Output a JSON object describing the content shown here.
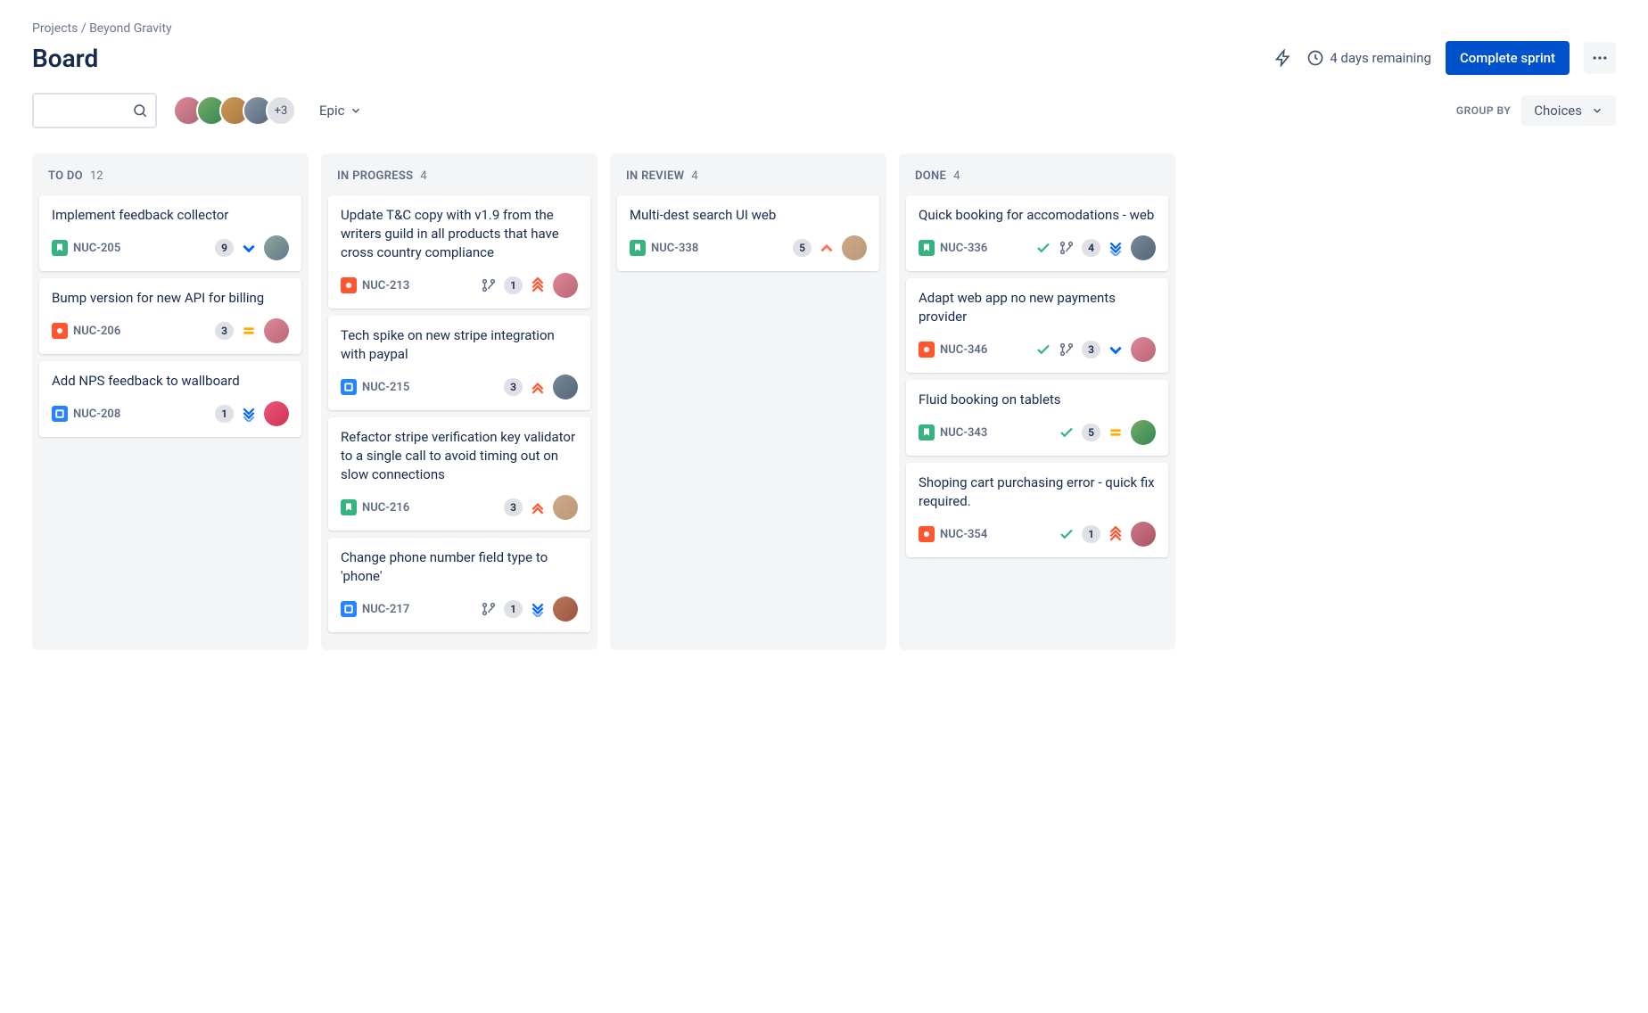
{
  "breadcrumb": {
    "projects": "Projects",
    "project_name": "Beyond Gravity"
  },
  "page_title": "Board",
  "header": {
    "time_remaining": "4 days remaining",
    "complete_sprint": "Complete sprint"
  },
  "toolbar": {
    "search_placeholder": "",
    "avatar_more": "+3",
    "epic_label": "Epic",
    "group_by_label": "GROUP BY",
    "choices_label": "Choices"
  },
  "columns": [
    {
      "title": "TO DO",
      "count": "12",
      "cards": [
        {
          "title": "Implement feedback collector",
          "type": "story",
          "key": "NUC-205",
          "estimate": "9",
          "priority": "low",
          "avatar": "a1"
        },
        {
          "title": "Bump version for new API for billing",
          "type": "bug",
          "key": "NUC-206",
          "estimate": "3",
          "priority": "medium",
          "avatar": "a2"
        },
        {
          "title": "Add NPS feedback to wallboard",
          "type": "task",
          "key": "NUC-208",
          "estimate": "1",
          "priority": "lowest",
          "avatar": "a3"
        }
      ]
    },
    {
      "title": "IN PROGRESS",
      "count": "4",
      "cards": [
        {
          "title": "Update T&C copy with v1.9 from the writers guild in all products that have cross country compliance",
          "type": "bug",
          "key": "NUC-213",
          "estimate": "1",
          "priority": "highest",
          "branch": true,
          "avatar": "a4"
        },
        {
          "title": "Tech spike on new stripe integration with paypal",
          "type": "task",
          "key": "NUC-215",
          "estimate": "3",
          "priority": "high",
          "avatar": "a5"
        },
        {
          "title": "Refactor stripe verification key validator to a single call to avoid timing out on slow connections",
          "type": "story",
          "key": "NUC-216",
          "estimate": "3",
          "priority": "high",
          "avatar": "a6"
        },
        {
          "title": "Change phone number field type to 'phone'",
          "type": "task",
          "key": "NUC-217",
          "estimate": "1",
          "priority": "lowest",
          "branch": true,
          "avatar": "a7"
        }
      ]
    },
    {
      "title": "IN REVIEW",
      "count": "4",
      "cards": [
        {
          "title": "Multi-dest search UI web",
          "type": "story",
          "key": "NUC-338",
          "estimate": "5",
          "priority": "medium-up",
          "avatar": "a8"
        }
      ]
    },
    {
      "title": "DONE",
      "count": "4",
      "cards": [
        {
          "title": "Quick booking for accomodations - web",
          "type": "story",
          "key": "NUC-336",
          "estimate": "4",
          "priority": "lowest",
          "done": true,
          "branch": true,
          "avatar": "a9"
        },
        {
          "title": "Adapt web app no new payments provider",
          "type": "bug",
          "key": "NUC-346",
          "estimate": "3",
          "priority": "low",
          "done": true,
          "branch": true,
          "avatar": "a10"
        },
        {
          "title": "Fluid booking on tablets",
          "type": "story",
          "key": "NUC-343",
          "estimate": "5",
          "priority": "medium",
          "done": true,
          "avatar": "a11"
        },
        {
          "title": "Shoping cart purchasing error - quick fix required.",
          "type": "bug",
          "key": "NUC-354",
          "estimate": "1",
          "priority": "highest",
          "done": true,
          "avatar": "a12"
        }
      ]
    }
  ]
}
